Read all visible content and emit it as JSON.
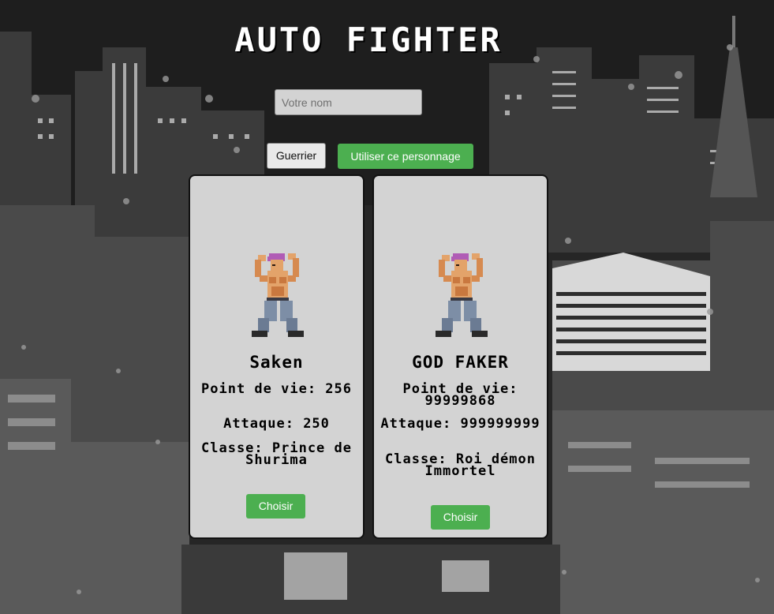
{
  "app": {
    "title": "AUTO FIGHTER"
  },
  "form": {
    "name_placeholder": "Votre nom",
    "class_button_label": "Guerrier",
    "use_character_label": "Utiliser ce personnage"
  },
  "fighters": [
    {
      "name": "Saken",
      "hp_label": "Point de vie: 256",
      "attack_label": "Attaque: 250",
      "class_label": "Classe: Prince de Shurima",
      "choose_label": "Choisir"
    },
    {
      "name": "GOD FAKER",
      "hp_label": "Point de vie: 99999868",
      "attack_label": "Attaque: 999999999",
      "class_label": "Classe: Roi démon Immortel",
      "choose_label": "Choisir"
    }
  ],
  "colors": {
    "accent_green": "#4caf50",
    "card_bg": "#d3d3d3",
    "background_dark": "#2a2a2a"
  }
}
